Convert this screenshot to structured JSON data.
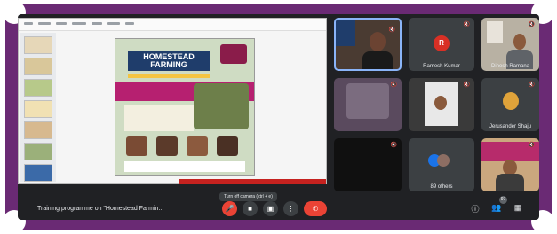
{
  "meeting": {
    "title": "Training programme on \"Homestead Farmin...",
    "tooltip": "Turn off camera (ctrl + e)"
  },
  "slide": {
    "title_line1": "HOMESTEAD",
    "title_line2": "FARMING"
  },
  "participants": [
    {
      "name": "",
      "muted": true
    },
    {
      "name": "Ramesh Kumar",
      "initial": "R",
      "muted": true
    },
    {
      "name": "Dinesh Ramana",
      "muted": true
    },
    {
      "name": "",
      "muted": true
    },
    {
      "name": "",
      "muted": true
    },
    {
      "name": "Jerusander Shaju",
      "muted": true
    },
    {
      "name": "",
      "muted": true
    },
    {
      "name": "89 others",
      "muted": false
    },
    {
      "name": "",
      "muted": true
    }
  ],
  "controls": {
    "mic_icon": "mic-off-icon",
    "camera_icon": "camera-icon",
    "present_icon": "present-icon",
    "more_icon": "more-icon",
    "hangup_icon": "hangup-icon"
  },
  "side": {
    "people_count": "97"
  },
  "colors": {
    "frame": "#6a2a74",
    "background": "#202124",
    "danger": "#ea4335",
    "tile": "#3c4043"
  }
}
